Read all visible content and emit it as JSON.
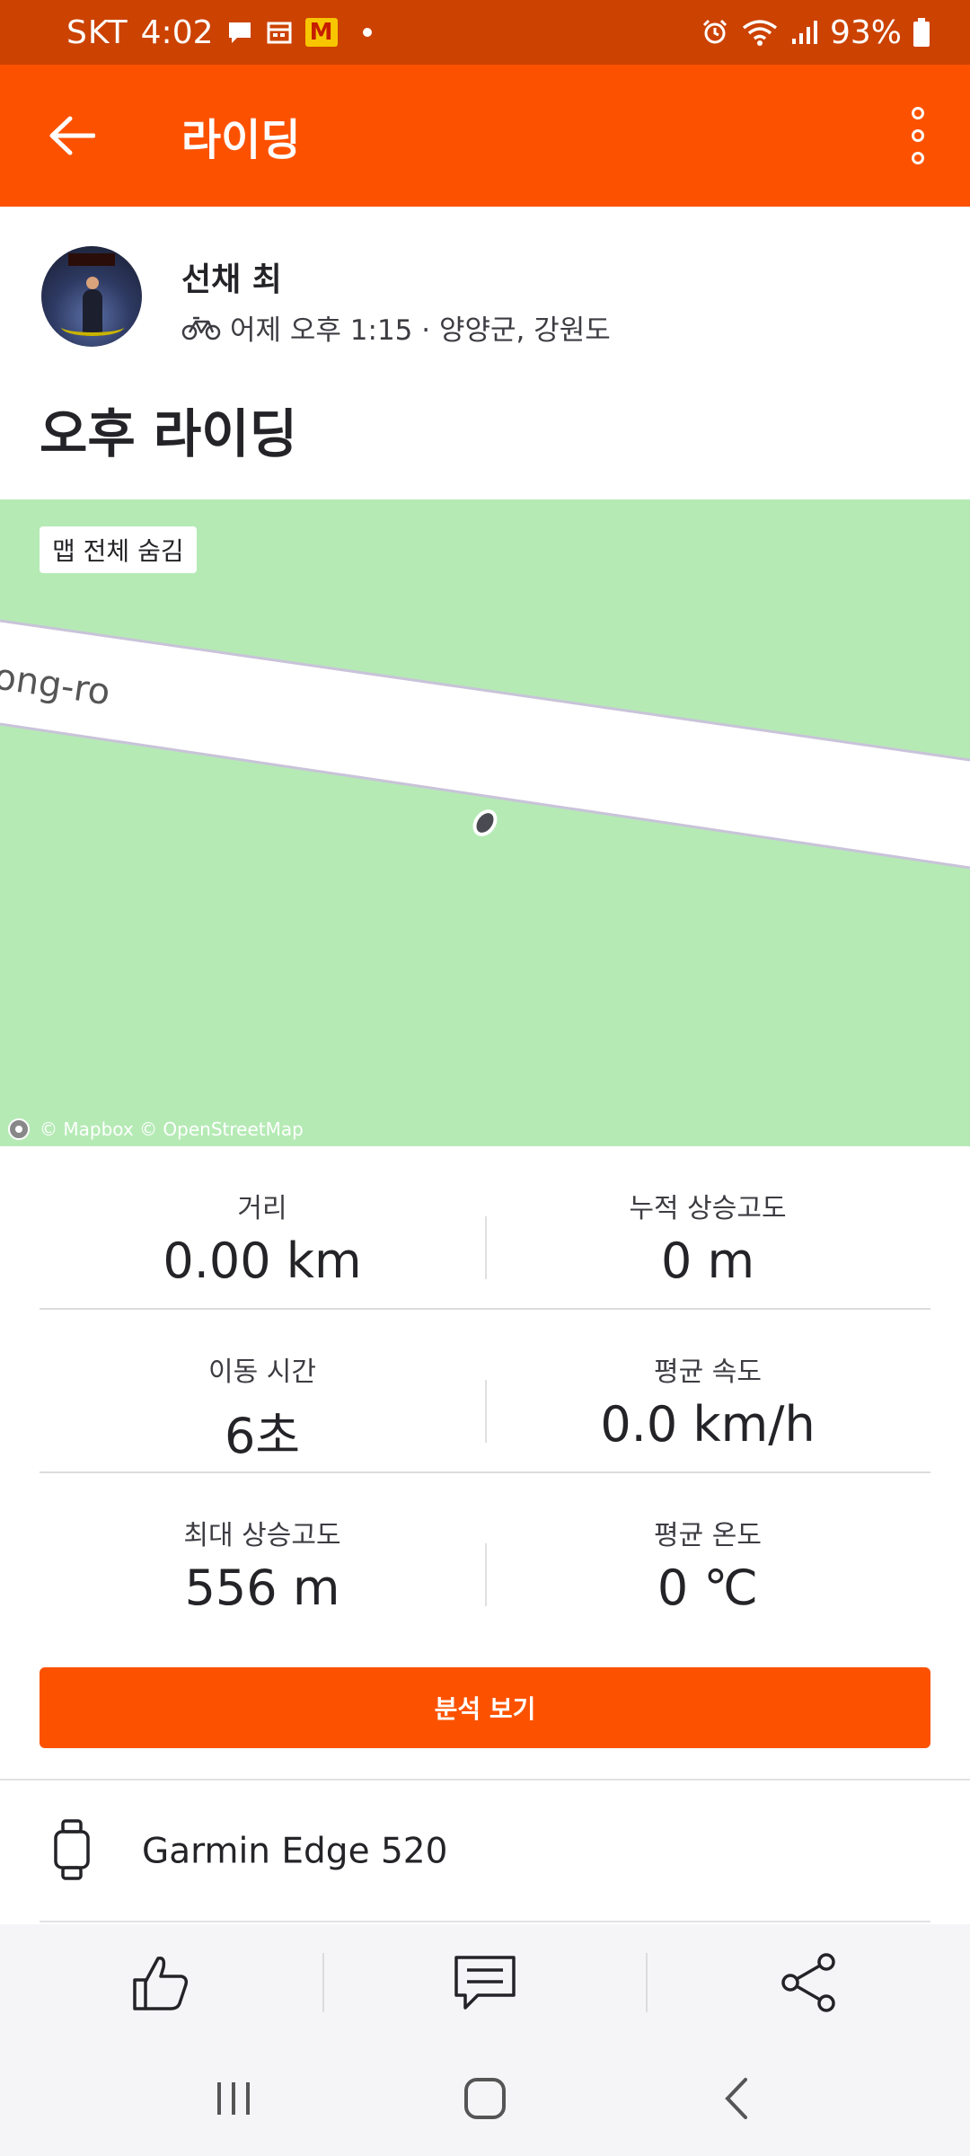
{
  "status_bar": {
    "carrier": "SKT",
    "time": "4:02",
    "notif_badge": "M",
    "battery": "93%",
    "icons": [
      "message-icon",
      "calendar-icon",
      "alarm-icon",
      "wifi-icon",
      "signal-icon",
      "battery-icon"
    ]
  },
  "app_bar": {
    "title": "라이딩",
    "back_icon": "arrow-left-icon",
    "more_icon": "more-vertical-icon"
  },
  "activity": {
    "athlete_name": "선채 최",
    "sport_icon": "bicycle-icon",
    "meta": "어제 오후 1:15 · 양양군, 강원도",
    "title": "오후 라이딩"
  },
  "map": {
    "hide_label": "맵 전체 숨김",
    "road_label": "ong-ro",
    "attribution": "© Mapbox © OpenStreetMap"
  },
  "stats": [
    [
      {
        "label": "거리",
        "value": "0.00 km"
      },
      {
        "label": "누적 상승고도",
        "value": "0 m"
      }
    ],
    [
      {
        "label": "이동 시간",
        "value": "6초"
      },
      {
        "label": "평균 속도",
        "value": "0.0 km/h"
      }
    ],
    [
      {
        "label": "최대 상승고도",
        "value": "556 m"
      },
      {
        "label": "평균 온도",
        "value": "0 ℃"
      }
    ]
  ],
  "analysis_button": "분석 보기",
  "device": {
    "name": "Garmin Edge 520",
    "icon": "watch-icon"
  },
  "actions": {
    "like_icon": "thumbs-up-icon",
    "comment_icon": "comment-icon",
    "share_icon": "share-icon"
  },
  "nav": {
    "recents_icon": "recents-icon",
    "home_icon": "home-icon",
    "back_icon": "back-icon"
  },
  "colors": {
    "brand": "#fc5200",
    "status_bar": "#cc4200",
    "map_land": "#b5eab5"
  }
}
